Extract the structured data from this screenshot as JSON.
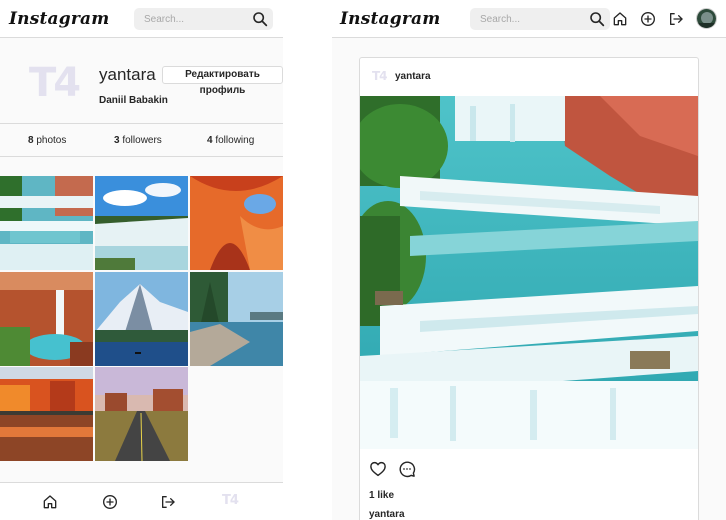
{
  "mobile": {
    "header": {
      "logo": "Instagram",
      "search_placeholder": "Search..."
    },
    "profile": {
      "avatar_text": "T4",
      "username": "yantara",
      "edit_button_label": "Редактировать профиль",
      "full_name": "Daniil Babakin"
    },
    "stats": {
      "photos_count": "8",
      "photos_label": "photos",
      "followers_count": "3",
      "followers_label": "followers",
      "following_count": "4",
      "following_label": "following"
    },
    "grid": [
      {
        "photo": "turquoise waterfall cascades"
      },
      {
        "photo": "niagara falls under blue sky"
      },
      {
        "photo": "orange slot canyon"
      },
      {
        "photo": "waterfall in red canyon"
      },
      {
        "photo": "snowy mountain over blue lake"
      },
      {
        "photo": "lake shore with pine trees"
      },
      {
        "photo": "autumn forest reflected in lake"
      },
      {
        "photo": "desert road to mesas"
      }
    ],
    "bottom_nav": {
      "icons": [
        "home-icon",
        "add-post-icon",
        "logout-icon"
      ],
      "avatar_text": "T4"
    }
  },
  "desktop": {
    "header": {
      "logo": "Instagram",
      "search_placeholder": "Search..."
    },
    "nav_icons": [
      "home-icon",
      "add-post-icon",
      "logout-icon",
      "user-avatar"
    ],
    "post": {
      "avatar_text": "T4",
      "username": "yantara",
      "image": "turquoise waterfall cascades",
      "likes_text": "1 like",
      "caption_user": "yantara"
    }
  },
  "colors": {
    "border": "#dbdbdb",
    "text": "#262626",
    "placeholder": "#a8a8a8",
    "avatar_text": "#e3e1ef",
    "background": "#fafafa"
  }
}
